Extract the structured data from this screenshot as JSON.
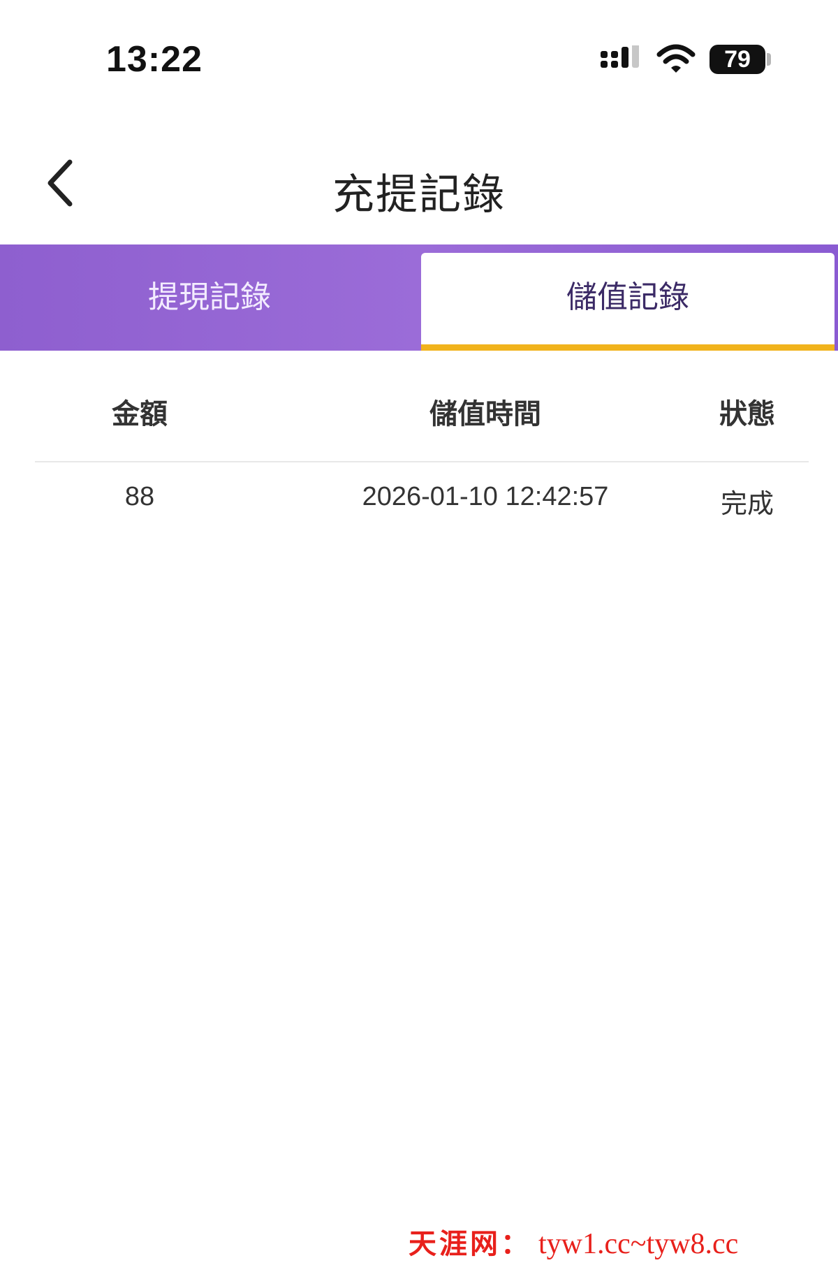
{
  "status_bar": {
    "time": "13:22",
    "battery_level": "79",
    "icons": [
      "signal-icon",
      "wifi-icon",
      "battery-icon"
    ]
  },
  "nav": {
    "title": "充提記錄",
    "back_icon": "chevron-left-icon"
  },
  "tabs": [
    {
      "label": "提現記錄",
      "active": false
    },
    {
      "label": "儲值記錄",
      "active": true
    }
  ],
  "table": {
    "headers": [
      "金額",
      "儲值時間",
      "狀態"
    ],
    "rows": [
      {
        "amount": "88",
        "time": "2026-01-10 12:42:57",
        "status": "完成"
      }
    ]
  },
  "watermark": {
    "cn": "天涯网：",
    "url": "tyw1.cc~tyw8.cc"
  },
  "colors": {
    "tab_bar": "#9466d6",
    "active_underline": "#f1b31c",
    "watermark": "#e8201b"
  }
}
